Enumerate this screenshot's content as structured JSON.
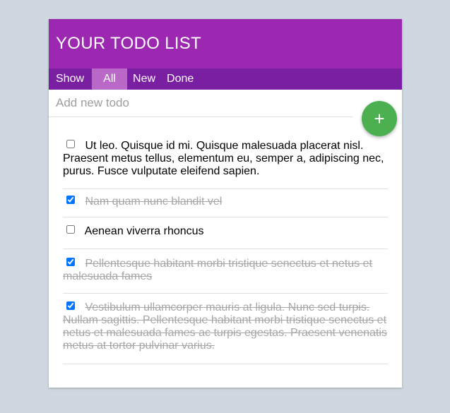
{
  "header": {
    "title": "YOUR TODO LIST"
  },
  "filter": {
    "show_label": "Show",
    "tabs": [
      {
        "label": "All",
        "active": true
      },
      {
        "label": "New",
        "active": false
      },
      {
        "label": "Done",
        "active": false
      }
    ]
  },
  "add": {
    "placeholder": "Add new todo",
    "button_label": "+"
  },
  "todos": [
    {
      "text": "Ut leo. Quisque id mi. Quisque malesuada placerat nisl. Praesent metus tellus, elementum eu, semper a, adipiscing nec, purus. Fusce vulputate eleifend sapien.",
      "done": false
    },
    {
      "text": "Nam quam nunc blandit vel",
      "done": true
    },
    {
      "text": "Aenean viverra rhoncus",
      "done": false
    },
    {
      "text": "Pellentesque habitant morbi tristique senectus et netus et malesuada fames",
      "done": true
    },
    {
      "text": "Vestibulum ullamcorper mauris at ligula. Nunc sed turpis. Nullam sagittis. Pellentesque habitant morbi tristique senectus et netus et malesuada fames ac turpis egestas. Praesent venenatis metus at tortor pulvinar varius.",
      "done": true
    }
  ],
  "colors": {
    "header_bg": "#9c27b0",
    "filter_bg": "#7b1fa2",
    "active_tab_bg": "#ba68c8",
    "add_button_bg": "#4caf50",
    "page_bg": "#cfd8e0"
  },
  "icons": {
    "add_button": "plus-icon"
  }
}
